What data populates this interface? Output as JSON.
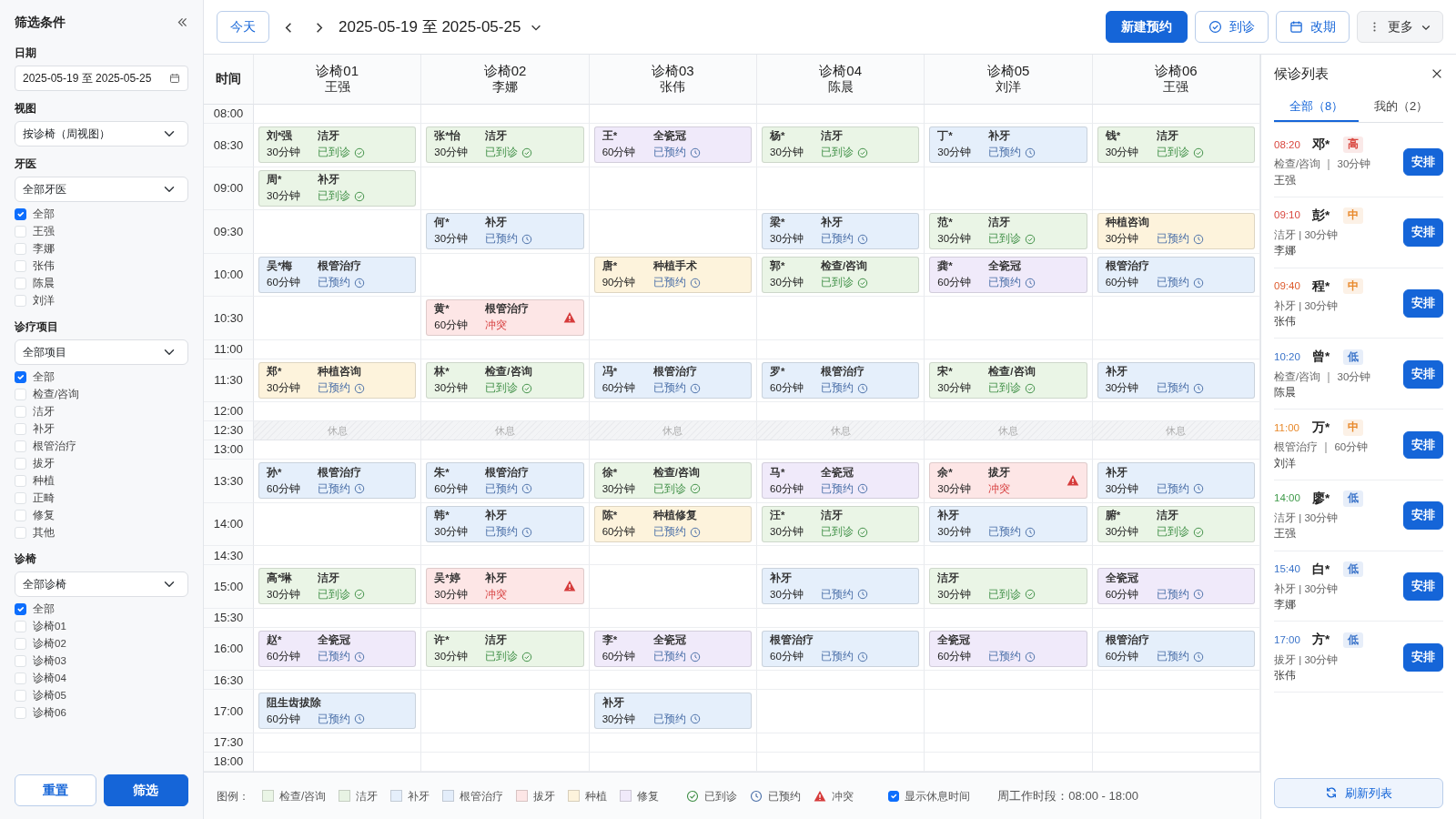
{
  "filters": {
    "title": "筛选条件",
    "date": {
      "label": "日期",
      "value": "2025-05-19 至 2025-05-25"
    },
    "view": {
      "label": "视图",
      "value": "按诊椅（周视图）"
    },
    "groups": [
      {
        "label": "牙医",
        "select": "全部牙医",
        "options": [
          {
            "label": "全部",
            "checked": true
          },
          {
            "label": "王强",
            "checked": false
          },
          {
            "label": "李娜",
            "checked": false
          },
          {
            "label": "张伟",
            "checked": false
          },
          {
            "label": "陈晨",
            "checked": false
          },
          {
            "label": "刘洋",
            "checked": false
          }
        ]
      },
      {
        "label": "诊疗项目",
        "select": "全部项目",
        "options": [
          {
            "label": "全部",
            "checked": true
          },
          {
            "label": "检查/咨询",
            "checked": false
          },
          {
            "label": "洁牙",
            "checked": false
          },
          {
            "label": "补牙",
            "checked": false
          },
          {
            "label": "根管治疗",
            "checked": false
          },
          {
            "label": "拔牙",
            "checked": false
          },
          {
            "label": "种植",
            "checked": false
          },
          {
            "label": "正畸",
            "checked": false
          },
          {
            "label": "修复",
            "checked": false
          },
          {
            "label": "其他",
            "checked": false
          }
        ]
      },
      {
        "label": "诊椅",
        "select": "全部诊椅",
        "options": [
          {
            "label": "全部",
            "checked": true
          },
          {
            "label": "诊椅01",
            "checked": false
          },
          {
            "label": "诊椅02",
            "checked": false
          },
          {
            "label": "诊椅03",
            "checked": false
          },
          {
            "label": "诊椅04",
            "checked": false
          },
          {
            "label": "诊椅05",
            "checked": false
          },
          {
            "label": "诊椅06",
            "checked": false
          }
        ]
      }
    ],
    "reset": "重置",
    "apply": "筛选"
  },
  "toolbar": {
    "today": "今天",
    "range": "2025-05-19 至 2025-05-25",
    "new": "新建预约",
    "checkin": "到诊",
    "reschedule": "改期",
    "more": "更多"
  },
  "schedule": {
    "time_header": "时间",
    "columns": [
      {
        "chair": "诊椅01",
        "dentist": "王强"
      },
      {
        "chair": "诊椅02",
        "dentist": "李娜"
      },
      {
        "chair": "诊椅03",
        "dentist": "张伟"
      },
      {
        "chair": "诊椅04",
        "dentist": "陈晨"
      },
      {
        "chair": "诊椅05",
        "dentist": "刘洋"
      },
      {
        "chair": "诊椅06",
        "dentist": "王强"
      }
    ],
    "rows": [
      {
        "time": "08:00",
        "cells": [
          {
            "kind": "empty"
          },
          {
            "kind": "empty"
          },
          {
            "kind": "empty"
          },
          {
            "kind": "empty"
          },
          {
            "kind": "empty"
          },
          {
            "kind": "empty"
          }
        ]
      },
      {
        "time": "08:30",
        "cells": [
          {
            "kind": "arrived",
            "name": "刘*强",
            "service": "洁牙",
            "duration": "30分钟",
            "status": "已到诊",
            "color": "#eaf5e6"
          },
          {
            "kind": "arrived",
            "name": "张*怡",
            "service": "洁牙",
            "duration": "30分钟",
            "status": "已到诊",
            "color": "#eaf5e6"
          },
          {
            "kind": "booked",
            "name": "王*",
            "service": "全瓷冠",
            "duration": "60分钟",
            "status": "已预约",
            "color": "#f0eafa"
          },
          {
            "kind": "arrived",
            "name": "杨*",
            "service": "洁牙",
            "duration": "30分钟",
            "status": "已到诊",
            "color": "#eaf5e6"
          },
          {
            "kind": "booked",
            "name": "丁*",
            "service": "补牙",
            "duration": "30分钟",
            "status": "已预约",
            "color": "#e5effb"
          },
          {
            "kind": "arrived",
            "name": "钱*",
            "service": "洁牙",
            "duration": "30分钟",
            "status": "已到诊",
            "color": "#eaf5e6"
          }
        ]
      },
      {
        "time": "09:00",
        "cells": [
          {
            "kind": "arrived",
            "name": "周*",
            "service": "补牙",
            "duration": "30分钟",
            "status": "已到诊",
            "color": "#eaf5e6"
          },
          {
            "kind": "empty"
          },
          {
            "kind": "empty"
          },
          {
            "kind": "empty"
          },
          {
            "kind": "empty"
          },
          {
            "kind": "empty"
          }
        ]
      },
      {
        "time": "09:30",
        "cells": [
          {
            "kind": "empty"
          },
          {
            "kind": "booked",
            "name": "何*",
            "service": "补牙",
            "duration": "30分钟",
            "status": "已预约",
            "color": "#e5effb"
          },
          {
            "kind": "empty"
          },
          {
            "kind": "booked",
            "name": "梁*",
            "service": "补牙",
            "duration": "30分钟",
            "status": "已预约",
            "color": "#e5effb"
          },
          {
            "kind": "arrived",
            "name": "范*",
            "service": "洁牙",
            "duration": "30分钟",
            "status": "已到诊",
            "color": "#eaf5e6"
          },
          {
            "kind": "booked",
            "service": "种植咨询",
            "duration": "30分钟",
            "status": "已预约",
            "color": "#fdf3dc"
          }
        ]
      },
      {
        "time": "10:00",
        "cells": [
          {
            "kind": "booked",
            "name": "吴*梅",
            "service": "根管治疗",
            "duration": "60分钟",
            "status": "已预约",
            "color": "#e5effb"
          },
          {
            "kind": "empty"
          },
          {
            "kind": "booked",
            "name": "唐*",
            "service": "种植手术",
            "duration": "90分钟",
            "status": "已预约",
            "color": "#fdf3dc"
          },
          {
            "kind": "arrived",
            "name": "郭*",
            "service": "检查/咨询",
            "duration": "30分钟",
            "status": "已到诊",
            "color": "#eaf5e6"
          },
          {
            "kind": "booked",
            "name": "龚*",
            "service": "全瓷冠",
            "duration": "60分钟",
            "status": "已预约",
            "color": "#f0eafa"
          },
          {
            "kind": "booked",
            "service": "根管治疗",
            "duration": "60分钟",
            "status": "已预约",
            "color": "#e5effb"
          }
        ]
      },
      {
        "time": "10:30",
        "cells": [
          {
            "kind": "empty"
          },
          {
            "kind": "conflict",
            "name": "黄*",
            "service": "根管治疗",
            "duration": "60分钟",
            "status": "冲突",
            "color": "#fde6e6"
          },
          {
            "kind": "empty"
          },
          {
            "kind": "empty"
          },
          {
            "kind": "empty"
          },
          {
            "kind": "empty"
          }
        ]
      },
      {
        "time": "11:00",
        "cells": [
          {
            "kind": "empty"
          },
          {
            "kind": "empty"
          },
          {
            "kind": "empty"
          },
          {
            "kind": "empty"
          },
          {
            "kind": "empty"
          },
          {
            "kind": "empty"
          }
        ]
      },
      {
        "time": "11:30",
        "cells": [
          {
            "kind": "booked",
            "name": "郑*",
            "service": "种植咨询",
            "duration": "30分钟",
            "status": "已预约",
            "color": "#fdf3dc"
          },
          {
            "kind": "arrived",
            "name": "林*",
            "service": "检查/咨询",
            "duration": "30分钟",
            "status": "已到诊",
            "color": "#eaf5e6"
          },
          {
            "kind": "booked",
            "name": "冯*",
            "service": "根管治疗",
            "duration": "60分钟",
            "status": "已预约",
            "color": "#e5effb"
          },
          {
            "kind": "booked",
            "name": "罗*",
            "service": "根管治疗",
            "duration": "60分钟",
            "status": "已预约",
            "color": "#e5effb"
          },
          {
            "kind": "arrived",
            "name": "宋*",
            "service": "检查/咨询",
            "duration": "30分钟",
            "status": "已到诊",
            "color": "#eaf5e6"
          },
          {
            "kind": "booked",
            "service": "补牙",
            "duration": "30分钟",
            "status": "已预约",
            "color": "#e5effb"
          }
        ]
      },
      {
        "time": "12:00",
        "cells": [
          {
            "kind": "empty"
          },
          {
            "kind": "empty"
          },
          {
            "kind": "empty"
          },
          {
            "kind": "empty"
          },
          {
            "kind": "empty"
          },
          {
            "kind": "empty"
          }
        ]
      },
      {
        "time": "12:30",
        "cells": [
          {
            "kind": "break",
            "label": "休息"
          },
          {
            "kind": "break",
            "label": "休息"
          },
          {
            "kind": "break",
            "label": "休息"
          },
          {
            "kind": "break",
            "label": "休息"
          },
          {
            "kind": "break",
            "label": "休息"
          },
          {
            "kind": "break",
            "label": "休息"
          }
        ]
      },
      {
        "time": "13:00",
        "cells": [
          {
            "kind": "empty"
          },
          {
            "kind": "empty"
          },
          {
            "kind": "empty"
          },
          {
            "kind": "empty"
          },
          {
            "kind": "empty"
          },
          {
            "kind": "empty"
          }
        ]
      },
      {
        "time": "13:30",
        "cells": [
          {
            "kind": "booked",
            "name": "孙*",
            "service": "根管治疗",
            "duration": "60分钟",
            "status": "已预约",
            "color": "#e5effb"
          },
          {
            "kind": "booked",
            "name": "朱*",
            "service": "根管治疗",
            "duration": "60分钟",
            "status": "已预约",
            "color": "#e5effb"
          },
          {
            "kind": "arrived",
            "name": "徐*",
            "service": "检查/咨询",
            "duration": "30分钟",
            "status": "已到诊",
            "color": "#eaf5e6"
          },
          {
            "kind": "booked",
            "name": "马*",
            "service": "全瓷冠",
            "duration": "60分钟",
            "status": "已预约",
            "color": "#f0eafa"
          },
          {
            "kind": "conflict",
            "name": "余*",
            "service": "拔牙",
            "duration": "30分钟",
            "status": "冲突",
            "color": "#fde6e6"
          },
          {
            "kind": "booked",
            "service": "补牙",
            "duration": "30分钟",
            "status": "已预约",
            "color": "#e5effb"
          }
        ]
      },
      {
        "time": "14:00",
        "cells": [
          {
            "kind": "empty"
          },
          {
            "kind": "booked",
            "name": "韩*",
            "service": "补牙",
            "duration": "30分钟",
            "status": "已预约",
            "color": "#e5effb"
          },
          {
            "kind": "booked",
            "name": "陈*",
            "service": "种植修复",
            "duration": "60分钟",
            "status": "已预约",
            "color": "#fdf3dc"
          },
          {
            "kind": "arrived",
            "name": "汪*",
            "service": "洁牙",
            "duration": "30分钟",
            "status": "已到诊",
            "color": "#eaf5e6"
          },
          {
            "kind": "booked",
            "service": "补牙",
            "duration": "30分钟",
            "status": "已预约",
            "color": "#e5effb"
          },
          {
            "kind": "arrived",
            "name": "腑*",
            "service": "洁牙",
            "duration": "30分钟",
            "status": "已到诊",
            "color": "#eaf5e6"
          }
        ]
      },
      {
        "time": "14:30",
        "cells": [
          {
            "kind": "empty"
          },
          {
            "kind": "empty"
          },
          {
            "kind": "empty"
          },
          {
            "kind": "empty"
          },
          {
            "kind": "empty"
          },
          {
            "kind": "empty"
          }
        ]
      },
      {
        "time": "15:00",
        "cells": [
          {
            "kind": "arrived",
            "name": "高*琳",
            "service": "洁牙",
            "duration": "30分钟",
            "status": "已到诊",
            "color": "#eaf5e6"
          },
          {
            "kind": "conflict",
            "name": "吴*婷",
            "service": "补牙",
            "duration": "30分钟",
            "status": "冲突",
            "color": "#fde6e6"
          },
          {
            "kind": "empty"
          },
          {
            "kind": "booked",
            "service": "补牙",
            "duration": "30分钟",
            "status": "已预约",
            "color": "#e5effb"
          },
          {
            "kind": "arrived",
            "service": "洁牙",
            "duration": "30分钟",
            "status": "已到诊",
            "color": "#eaf5e6"
          },
          {
            "kind": "booked",
            "service": "全瓷冠",
            "duration": "60分钟",
            "status": "已预约",
            "color": "#f0eafa"
          }
        ]
      },
      {
        "time": "15:30",
        "cells": [
          {
            "kind": "empty"
          },
          {
            "kind": "empty"
          },
          {
            "kind": "empty"
          },
          {
            "kind": "empty"
          },
          {
            "kind": "empty"
          },
          {
            "kind": "empty"
          }
        ]
      },
      {
        "time": "16:00",
        "cells": [
          {
            "kind": "booked",
            "name": "赵*",
            "service": "全瓷冠",
            "duration": "60分钟",
            "status": "已预约",
            "color": "#f0eafa"
          },
          {
            "kind": "arrived",
            "name": "许*",
            "service": "洁牙",
            "duration": "30分钟",
            "status": "已到诊",
            "color": "#eaf5e6"
          },
          {
            "kind": "booked",
            "name": "李*",
            "service": "全瓷冠",
            "duration": "60分钟",
            "status": "已预约",
            "color": "#f0eafa"
          },
          {
            "kind": "booked",
            "service": "根管治疗",
            "duration": "60分钟",
            "status": "已预约",
            "color": "#e5effb"
          },
          {
            "kind": "booked",
            "service": "全瓷冠",
            "duration": "60分钟",
            "status": "已预约",
            "color": "#f0eafa"
          },
          {
            "kind": "booked",
            "service": "根管治疗",
            "duration": "60分钟",
            "status": "已预约",
            "color": "#e5effb"
          }
        ]
      },
      {
        "time": "16:30",
        "cells": [
          {
            "kind": "empty"
          },
          {
            "kind": "empty"
          },
          {
            "kind": "empty"
          },
          {
            "kind": "empty"
          },
          {
            "kind": "empty"
          },
          {
            "kind": "empty"
          }
        ]
      },
      {
        "time": "17:00",
        "cells": [
          {
            "kind": "booked",
            "service": "阻生齿拔除",
            "duration": "60分钟",
            "status": "已预约",
            "color": "#e5effb"
          },
          {
            "kind": "empty"
          },
          {
            "kind": "booked",
            "service": "补牙",
            "duration": "30分钟",
            "status": "已预约",
            "color": "#e5effb"
          },
          {
            "kind": "empty"
          },
          {
            "kind": "empty"
          },
          {
            "kind": "empty"
          }
        ]
      },
      {
        "time": "17:30",
        "cells": [
          {
            "kind": "empty"
          },
          {
            "kind": "empty"
          },
          {
            "kind": "empty"
          },
          {
            "kind": "empty"
          },
          {
            "kind": "empty"
          },
          {
            "kind": "empty"
          }
        ]
      },
      {
        "time": "18:00",
        "cells": [
          {
            "kind": "empty"
          },
          {
            "kind": "empty"
          },
          {
            "kind": "empty"
          },
          {
            "kind": "empty"
          },
          {
            "kind": "empty"
          },
          {
            "kind": "empty"
          }
        ]
      }
    ]
  },
  "legend": {
    "title": "图例：",
    "categories": [
      {
        "label": "检查/咨询",
        "color": "#eaf5e6"
      },
      {
        "label": "洁牙",
        "color": "#e8f3e4"
      },
      {
        "label": "补牙",
        "color": "#e5effb"
      },
      {
        "label": "根管治疗",
        "color": "#e3edfa"
      },
      {
        "label": "拔牙",
        "color": "#fde6e6"
      },
      {
        "label": "种植",
        "color": "#fdf3dc"
      },
      {
        "label": "修复",
        "color": "#f0eafa"
      }
    ],
    "statuses": [
      {
        "kind": "arrived",
        "label": "已到诊"
      },
      {
        "kind": "booked",
        "label": "已预约"
      },
      {
        "kind": "conflict",
        "label": "冲突"
      }
    ],
    "show_breaks": {
      "label": "显示休息时间",
      "checked": true
    },
    "hours": "周工作时段：08:00 - 18:00"
  },
  "waitlist": {
    "title": "候诊列表",
    "tabs": [
      {
        "label": "全部（8）",
        "selected": true
      },
      {
        "label": "我的（2）",
        "selected": false
      }
    ],
    "items": [
      {
        "time": "08:20",
        "color": "#d9463e",
        "name": "邓*",
        "priority": {
          "label": "高",
          "color": "#d9463e"
        },
        "detail": "检查/咨询 ｜ 30分钟",
        "dentist": "王强",
        "action": "安排"
      },
      {
        "time": "09:10",
        "color": "#d9463e",
        "name": "彭*",
        "priority": {
          "label": "中",
          "color": "#e8892b"
        },
        "detail": "洁牙 | 30分钟",
        "dentist": "李娜",
        "action": "安排"
      },
      {
        "time": "09:40",
        "color": "#dd5a2c",
        "name": "程*",
        "priority": {
          "label": "中",
          "color": "#e8892b"
        },
        "detail": "补牙 | 30分钟",
        "dentist": "张伟",
        "action": "安排"
      },
      {
        "time": "10:20",
        "color": "#3a73c9",
        "name": "曾*",
        "priority": {
          "label": "低",
          "color": "#3a73c9"
        },
        "detail": "检查/咨询 ｜ 30分钟",
        "dentist": "陈晨",
        "action": "安排"
      },
      {
        "time": "11:00",
        "color": "#e8892b",
        "name": "万*",
        "priority": {
          "label": "中",
          "color": "#e8892b"
        },
        "detail": "根管治疗 ｜ 60分钟",
        "dentist": "刘洋",
        "action": "安排"
      },
      {
        "time": "14:00",
        "color": "#3f9a4a",
        "name": "廖*",
        "priority": {
          "label": "低",
          "color": "#3a73c9"
        },
        "detail": "洁牙 | 30分钟",
        "dentist": "王强",
        "action": "安排"
      },
      {
        "time": "15:40",
        "color": "#3a73c9",
        "name": "白*",
        "priority": {
          "label": "低",
          "color": "#3a73c9"
        },
        "detail": "补牙 | 30分钟",
        "dentist": "李娜",
        "action": "安排"
      },
      {
        "time": "17:00",
        "color": "#3a73c9",
        "name": "方*",
        "priority": {
          "label": "低",
          "color": "#3a73c9"
        },
        "detail": "拔牙 | 30分钟",
        "dentist": "张伟",
        "action": "安排"
      }
    ],
    "refresh": "刷新列表"
  }
}
